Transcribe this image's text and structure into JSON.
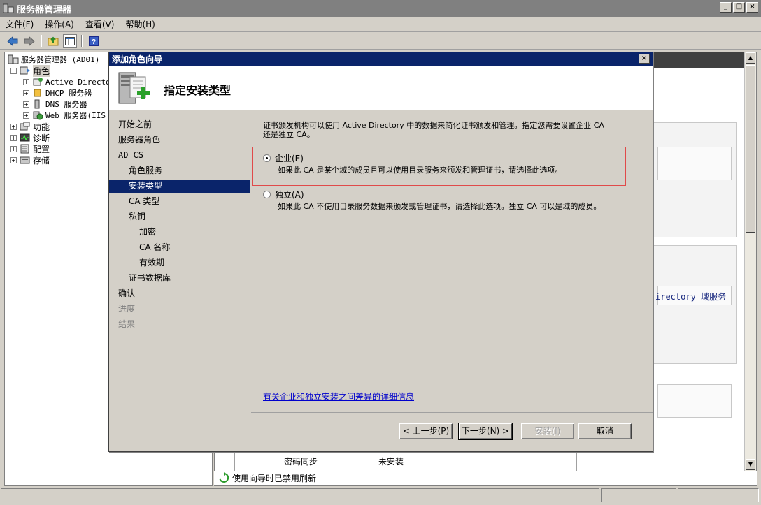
{
  "window": {
    "title": "服务器管理器",
    "buttons": [
      "_",
      "□",
      "×"
    ]
  },
  "menu": [
    "文件(F)",
    "操作(A)",
    "查看(V)",
    "帮助(H)"
  ],
  "tree": {
    "root": "服务器管理器 (AD01)",
    "roles": "角色",
    "role_items": [
      "Active Directo",
      "DHCP 服务器",
      "DNS 服务器",
      "Web 服务器(IIS"
    ],
    "features": "功能",
    "diagnostics": "诊断",
    "config": "配置",
    "storage": "存储"
  },
  "behind": {
    "ad_text": "irectory 域服务",
    "row_name": "密码同步",
    "row_status": "未安装",
    "refresh_text": "使用向导时已禁用刷新"
  },
  "wizard": {
    "title": "添加角色向导",
    "close": "×",
    "header_title": "指定安装类型",
    "nav": [
      {
        "label": "开始之前",
        "state": "normal",
        "indent": 0
      },
      {
        "label": "服务器角色",
        "state": "normal",
        "indent": 0
      },
      {
        "label": "AD CS",
        "state": "normal",
        "indent": 0
      },
      {
        "label": "角色服务",
        "state": "normal",
        "indent": 1
      },
      {
        "label": "安装类型",
        "state": "active",
        "indent": 1
      },
      {
        "label": "CA 类型",
        "state": "normal",
        "indent": 1
      },
      {
        "label": "私钥",
        "state": "normal",
        "indent": 1
      },
      {
        "label": "加密",
        "state": "normal",
        "indent": 2
      },
      {
        "label": "CA 名称",
        "state": "normal",
        "indent": 2
      },
      {
        "label": "有效期",
        "state": "normal",
        "indent": 2
      },
      {
        "label": "证书数据库",
        "state": "normal",
        "indent": 1
      },
      {
        "label": "确认",
        "state": "normal",
        "indent": 0
      },
      {
        "label": "进度",
        "state": "disabled",
        "indent": 0
      },
      {
        "label": "结果",
        "state": "disabled",
        "indent": 0
      }
    ],
    "description_line1": "证书颁发机构可以使用 Active Directory 中的数据来简化证书颁发和管理。指定您需要设置企业 CA",
    "description_line2": "还是独立 CA。",
    "options": {
      "enterprise_label": "企业(E)",
      "enterprise_desc": "如果此 CA 是某个域的成员且可以使用目录服务来颁发和管理证书，请选择此选项。",
      "enterprise_checked": true,
      "standalone_label": "独立(A)",
      "standalone_desc": "如果此 CA 不使用目录服务数据来颁发或管理证书，请选择此选项。独立 CA 可以是域的成员。",
      "standalone_checked": false
    },
    "link": "有关企业和独立安装之间差异的详细信息",
    "buttons": {
      "back": "< 上一步(P)",
      "next": "下一步(N) >",
      "install": "安装(I)",
      "cancel": "取消"
    }
  }
}
